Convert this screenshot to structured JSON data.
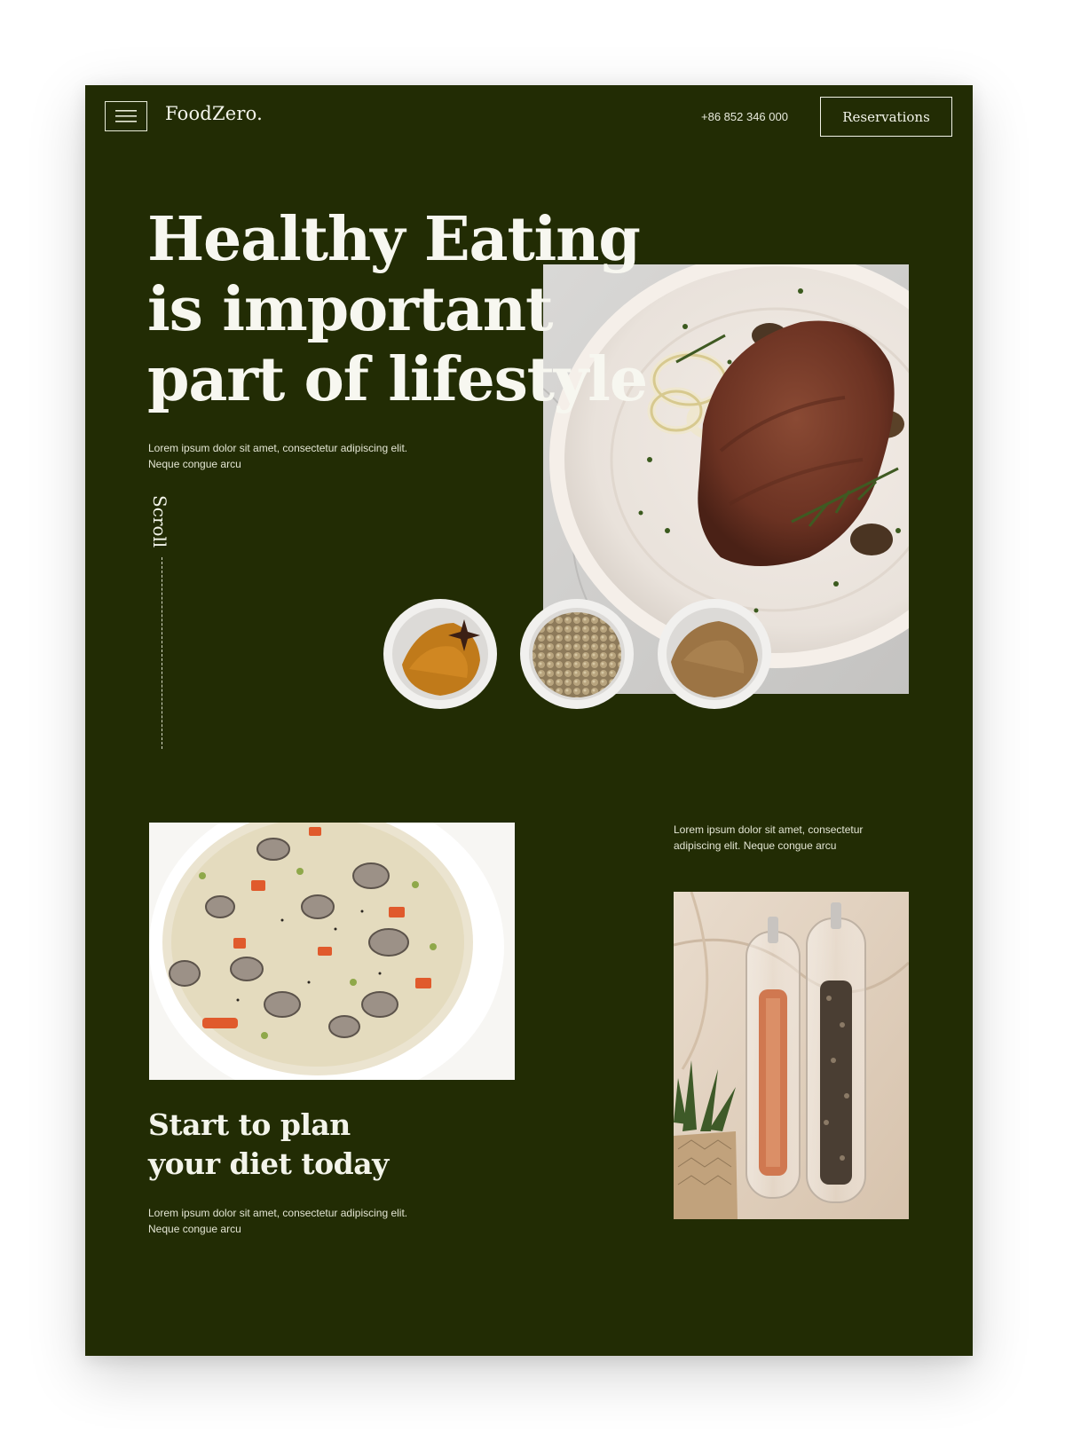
{
  "header": {
    "brand": "FoodZero.",
    "phone": "+86 852 346 000",
    "reservations_label": "Reservations"
  },
  "hero": {
    "title_lines": [
      "Healthy Eating",
      "is important",
      "part of lifestyle"
    ],
    "description": "Lorem ipsum dolor sit amet, consectetur adipiscing elit. Neque congue arcu",
    "scroll_label": "Scroll"
  },
  "plan": {
    "title_lines": [
      "Start to plan",
      "your diet today"
    ],
    "description": "Lorem ipsum dolor sit amet, consectetur adipiscing elit. Neque congue arcu",
    "side_description": "Lorem ipsum dolor sit amet, consectetur adipiscing elit. Neque congue arcu"
  },
  "icons": {
    "menu": "hamburger-menu-icon"
  },
  "colors": {
    "page_background": "#222c04",
    "text_primary": "#f7f7f0",
    "outer_background": "#ffffff"
  }
}
